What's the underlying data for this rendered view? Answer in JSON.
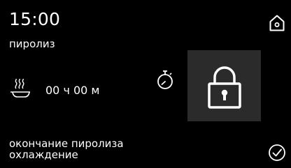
{
  "header": {
    "time": "15:00",
    "mode": "пиролиз"
  },
  "timer": {
    "duration": "00 ч 00 м",
    "icon": "stopwatch-icon"
  },
  "heating": {
    "icon": "hot-dish-icon"
  },
  "lock": {
    "icon": "padlock-icon",
    "state": "locked"
  },
  "status": {
    "line1": "окончание пиролиза",
    "line2": "охлаждение"
  },
  "controls": {
    "home_icon": "home-icon",
    "confirm_icon": "checkmark-circle-icon"
  },
  "colors": {
    "background": "#000000",
    "text": "#ffffff",
    "lock_panel": "#2b2b2b"
  }
}
